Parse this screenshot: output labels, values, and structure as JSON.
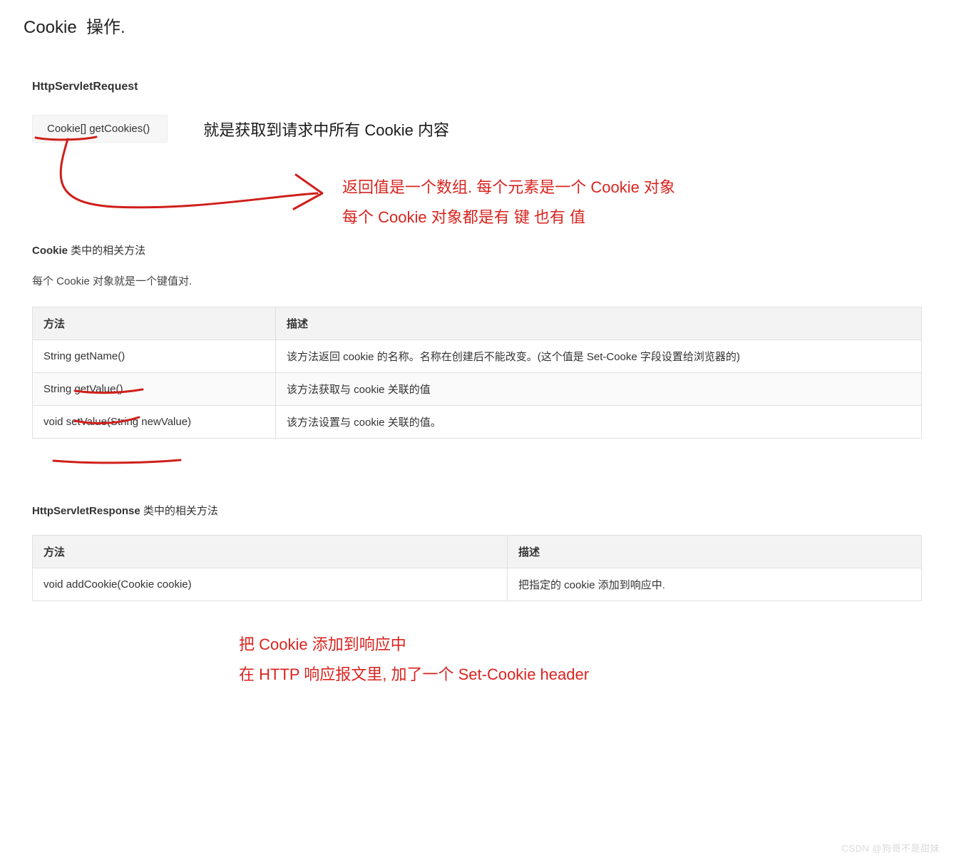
{
  "title": "Cookie  操作.",
  "section1": {
    "heading": "HttpServletRequest",
    "codeChip": "Cookie[] getCookies()",
    "lineText": "就是获取到请求中所有 Cookie 内容"
  },
  "annotation1": {
    "line1": "返回值是一个数组. 每个元素是一个 Cookie 对象",
    "line2": "每个 Cookie 对象都是有 键 也有 值"
  },
  "cookieClass": {
    "headingBold": "Cookie",
    "headingRest": " 类中的相关方法",
    "para": "每个 Cookie 对象就是一个键值对."
  },
  "table1": {
    "headers": {
      "c1": "方法",
      "c2": "描述"
    },
    "rows": [
      {
        "c1": "String getName()",
        "c2": "该方法返回 cookie 的名称。名称在创建后不能改变。(这个值是 Set-Cooke 字段设置给浏览器的)"
      },
      {
        "c1": "String getValue()",
        "c2": "该方法获取与 cookie 关联的值"
      },
      {
        "c1": "void setValue(String newValue)",
        "c2": "该方法设置与 cookie 关联的值。"
      }
    ]
  },
  "section2": {
    "headingBold": "HttpServletResponse",
    "headingRest": " 类中的相关方法"
  },
  "table2": {
    "headers": {
      "c1": "方法",
      "c2": "描述"
    },
    "rows": [
      {
        "c1": "void addCookie(Cookie cookie)",
        "c2": "把指定的 cookie 添加到响应中."
      }
    ]
  },
  "annotation2": {
    "line1": "把 Cookie 添加到响应中",
    "line2": "在 HTTP 响应报文里, 加了一个 Set-Cookie header"
  },
  "watermark": "CSDN @狗哥不是甜妹"
}
